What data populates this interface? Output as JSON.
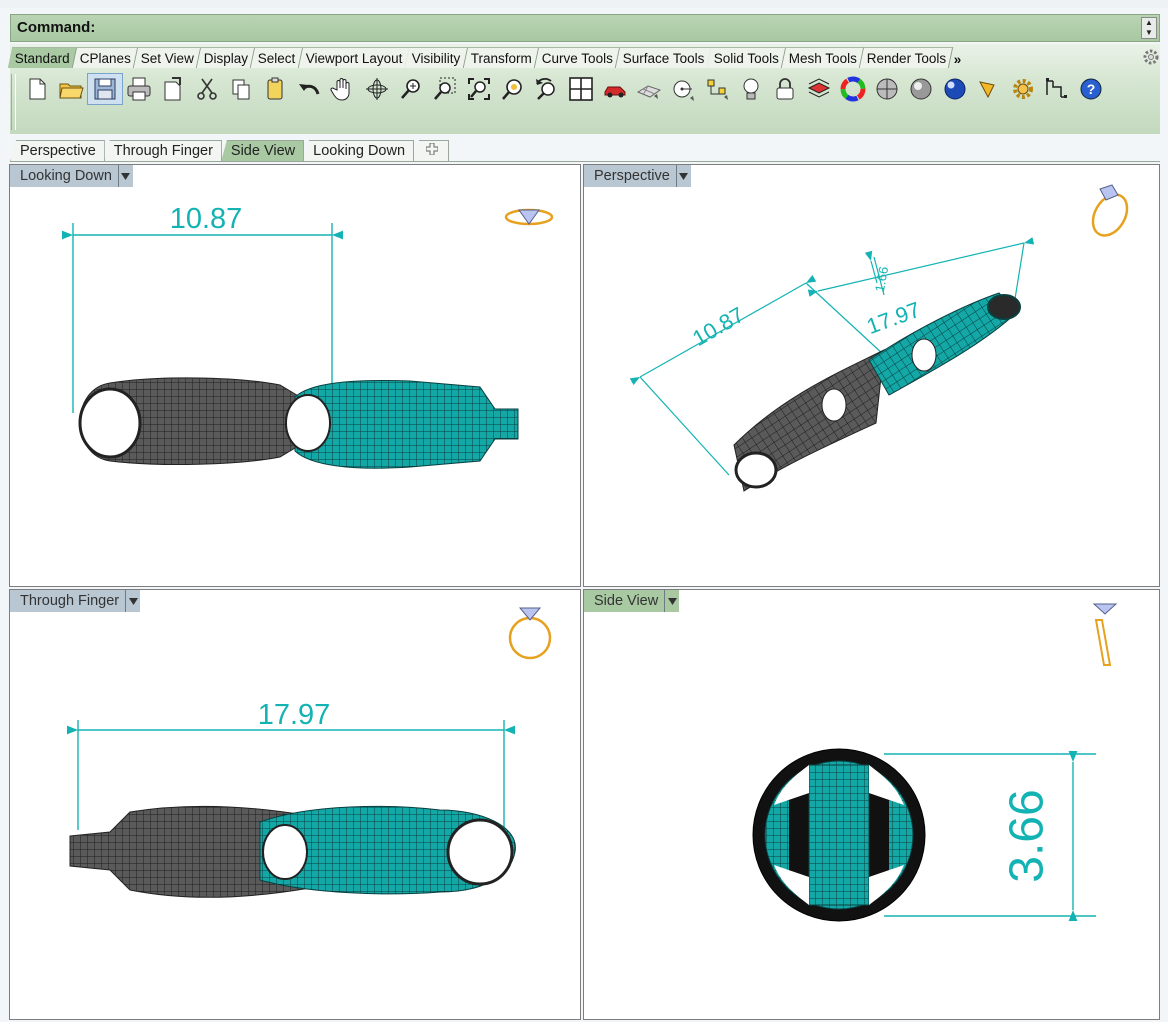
{
  "command": {
    "label": "Command:"
  },
  "toolbar_tabs": [
    {
      "label": "Standard",
      "active": true
    },
    {
      "label": "CPlanes"
    },
    {
      "label": "Set View"
    },
    {
      "label": "Display"
    },
    {
      "label": "Select"
    },
    {
      "label": "Viewport Layout"
    },
    {
      "label": "Visibility"
    },
    {
      "label": "Transform"
    },
    {
      "label": "Curve Tools"
    },
    {
      "label": "Surface Tools"
    },
    {
      "label": "Solid Tools"
    },
    {
      "label": "Mesh Tools"
    },
    {
      "label": "Render Tools"
    }
  ],
  "toolbar_more": "»",
  "tool_icons": [
    "new-file-icon",
    "open-folder-icon",
    "save-icon",
    "print-icon",
    "import-icon",
    "cut-icon",
    "copy-icon",
    "paste-icon",
    "undo-icon",
    "pan-hand-icon",
    "rotate-view-icon",
    "zoom-dynamic-icon",
    "zoom-window-icon",
    "zoom-extents-icon",
    "zoom-selected-icon",
    "undo-view-icon",
    "four-viewports-icon",
    "car-icon",
    "plane-grid-icon",
    "osnap-icon",
    "select-points-icon",
    "lightbulb-icon",
    "lock-icon",
    "layer-icon",
    "color-wheel-icon",
    "render-sphere-icon",
    "shaded-sphere-icon",
    "blue-sphere-icon",
    "lamp-icon",
    "settings-gear-icon",
    "dimension-icon",
    "help-icon"
  ],
  "viewport_tabs": [
    {
      "label": "Perspective"
    },
    {
      "label": "Through Finger"
    },
    {
      "label": "Side View",
      "active": true
    },
    {
      "label": "Looking Down"
    }
  ],
  "viewports": {
    "looking_down": {
      "title": "Looking Down",
      "dimension": "10.87"
    },
    "perspective": {
      "title": "Perspective",
      "dimension_a": "10.87",
      "dimension_b": "17.97",
      "dimension_c": "1.66"
    },
    "through_finger": {
      "title": "Through Finger",
      "dimension": "17.97"
    },
    "side_view": {
      "title": "Side View",
      "dimension": "3.66"
    }
  },
  "colors": {
    "teal": "#15a8a8",
    "dim": "#13b3b3",
    "panel_green": "#a9c9a3",
    "title_blue": "#b9c7d2",
    "gold": "#e6a11e"
  }
}
